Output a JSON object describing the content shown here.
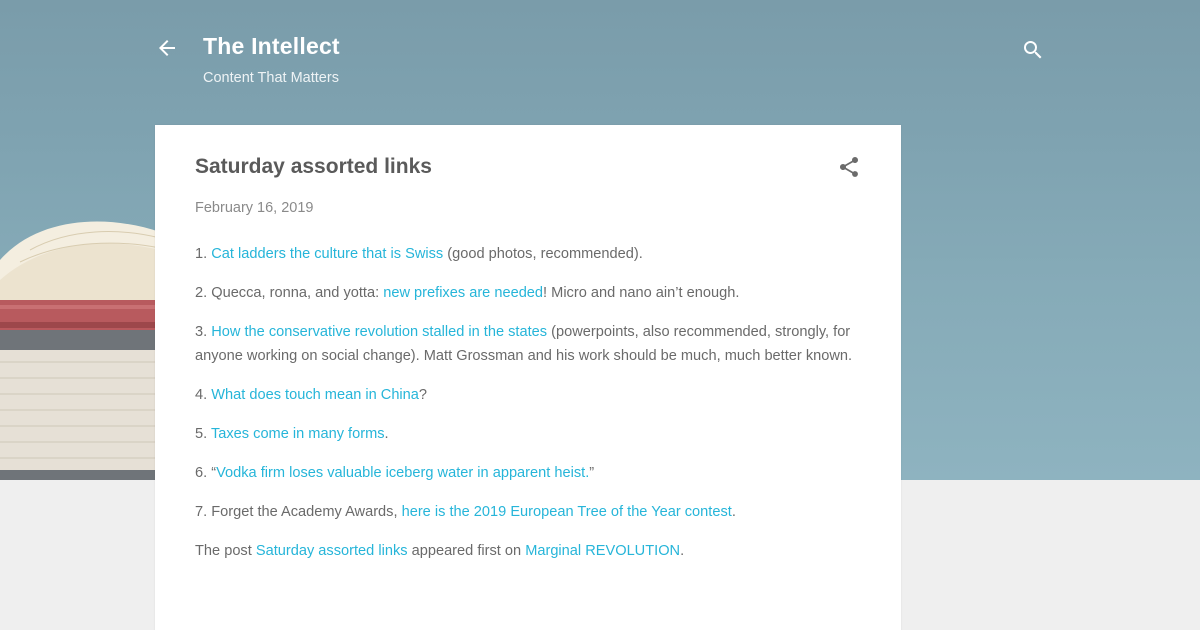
{
  "header": {
    "title": "The Intellect",
    "description": "Content That Matters",
    "back_icon": "arrow-back-icon",
    "search_icon": "search-icon"
  },
  "post": {
    "title": "Saturday assorted links",
    "date": "February 16, 2019",
    "share_icon": "share-icon",
    "items": [
      {
        "prefix": "1. ",
        "link": "Cat ladders the culture that is Swiss",
        "suffix": " (good photos, recommended)."
      },
      {
        "prefix": "2. Quecca, ronna, and yotta: ",
        "link": "new prefixes are needed",
        "suffix": "!  Micro and nano ain’t enough."
      },
      {
        "prefix": "3. ",
        "link": "How the conservative revolution stalled in the states",
        "suffix": " (powerpoints, also recommended, strongly, for anyone working on social change).  Matt Grossman and his work should be much, much better known."
      },
      {
        "prefix": "4. ",
        "link": "What does touch mean in China",
        "suffix": "?"
      },
      {
        "prefix": "5. ",
        "link": "Taxes come in many forms",
        "suffix": "."
      },
      {
        "prefix": "6. “",
        "link": "Vodka firm loses valuable iceberg water in apparent heist.",
        "suffix": "”"
      },
      {
        "prefix": "7. Forget the Academy Awards, ",
        "link": "here is the 2019 European Tree of the Year contest",
        "suffix": "."
      }
    ],
    "footer": {
      "prefix": "The post ",
      "post_link": "Saturday assorted links",
      "middle": " appeared first on ",
      "site_link": "Marginal REVOLUTION",
      "suffix": "."
    }
  },
  "colors": {
    "link": "#26b5d9",
    "header_bg": "#7fa3b1",
    "page_bg": "#efefef"
  }
}
